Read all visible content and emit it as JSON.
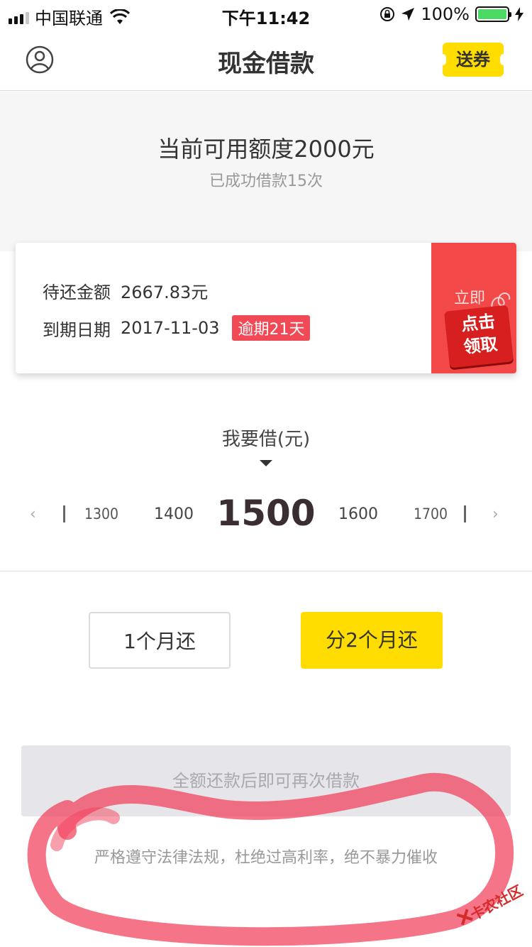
{
  "status_bar": {
    "carrier": "中国联通",
    "time": "下午11:42",
    "battery": "100%"
  },
  "nav": {
    "title": "现金借款",
    "coupon_label": "送券"
  },
  "summary": {
    "quota_text": "当前可用额度2000元",
    "count_text": "已成功借款15次"
  },
  "loan": {
    "due_amount_label": "待还金额",
    "due_amount_value": "2667.83元",
    "due_date_label": "到期日期",
    "due_date_value": "2017-11-03",
    "overdue_badge": "逾期21天"
  },
  "promo": {
    "top_text": "立即",
    "line1": "点击",
    "line2": "领取"
  },
  "borrow": {
    "label": "我要借(元)",
    "left_arrow": "‹",
    "right_arrow": "›",
    "amounts": [
      "1300",
      "1400",
      "1500",
      "1600",
      "1700"
    ],
    "selected": "1500"
  },
  "periods": {
    "option1": "1个月还",
    "option2": "分2个月还",
    "selected_index": 1
  },
  "submit": {
    "label": "全额还款后即可再次借款"
  },
  "footer": {
    "note": "严格遵守法律法规，杜绝过高利率，绝不暴力催收"
  },
  "watermark": {
    "text": "卡农社区"
  },
  "colors": {
    "accent_yellow": "#ffdd00",
    "overdue_red": "#f24957",
    "promo_red": "#f24848",
    "scribble_red": "#f23f5a"
  }
}
